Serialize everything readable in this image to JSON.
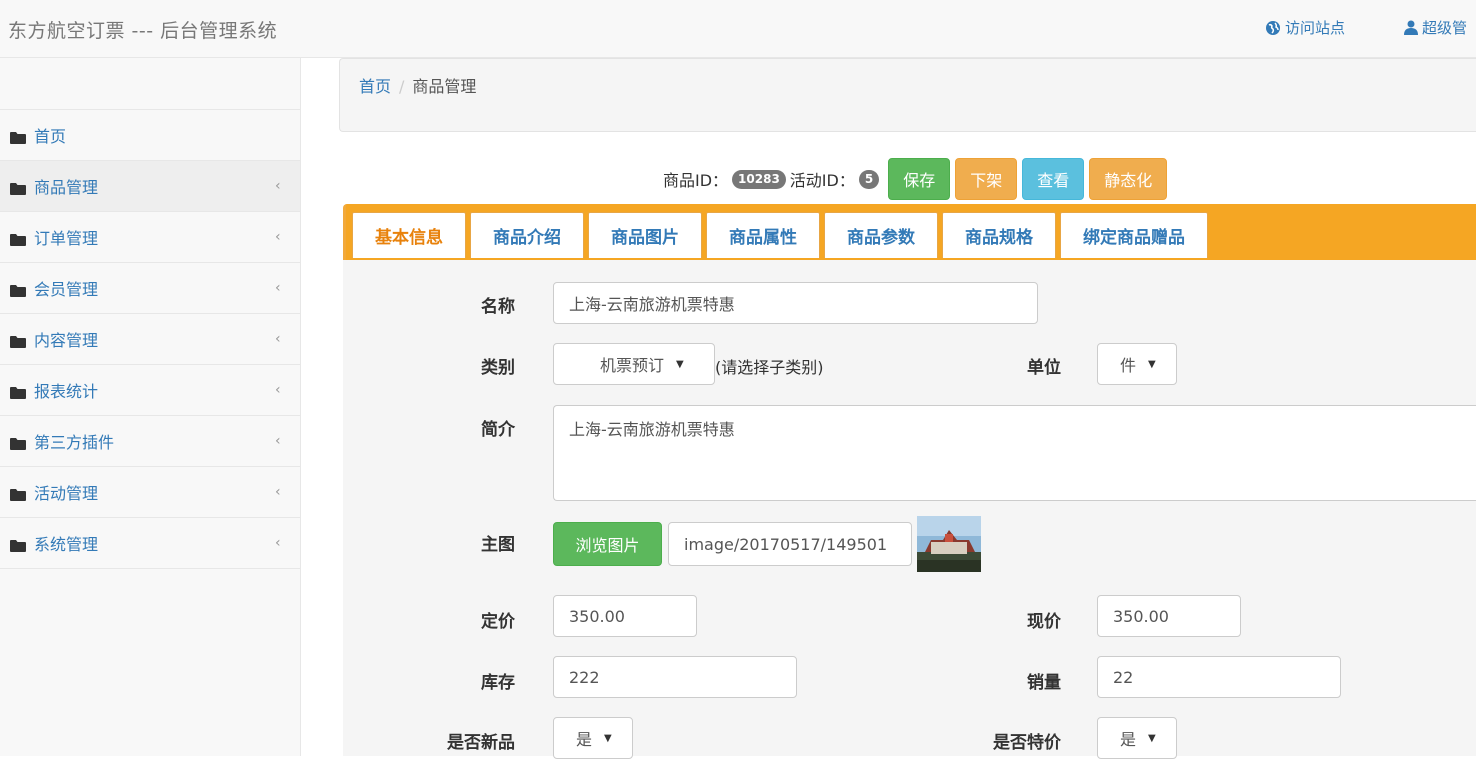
{
  "navbar": {
    "brand": "东方航空订票 --- 后台管理系统",
    "visit_site": "访问站点",
    "user": "超级管"
  },
  "sidebar": {
    "items": [
      {
        "label": "首页",
        "active": false,
        "has_chevron": false
      },
      {
        "label": "商品管理",
        "active": true,
        "has_chevron": true
      },
      {
        "label": "订单管理",
        "active": false,
        "has_chevron": true
      },
      {
        "label": "会员管理",
        "active": false,
        "has_chevron": true
      },
      {
        "label": "内容管理",
        "active": false,
        "has_chevron": true
      },
      {
        "label": "报表统计",
        "active": false,
        "has_chevron": true
      },
      {
        "label": "第三方插件",
        "active": false,
        "has_chevron": true
      },
      {
        "label": "活动管理",
        "active": false,
        "has_chevron": true
      },
      {
        "label": "系统管理",
        "active": false,
        "has_chevron": true
      }
    ],
    "chevron": "‹"
  },
  "breadcrumb": {
    "home": "首页",
    "sep": "/",
    "current": "商品管理"
  },
  "idbar": {
    "product_id_label": "商品ID：",
    "product_id": "10283",
    "activity_id_label": "活动ID：",
    "activity_id": "5",
    "save": "保存",
    "offshelf": "下架",
    "view": "查看",
    "staticize": "静态化"
  },
  "tabs": [
    "基本信息",
    "商品介绍",
    "商品图片",
    "商品属性",
    "商品参数",
    "商品规格",
    "绑定商品赠品"
  ],
  "form": {
    "name_label": "名称",
    "name_value": "上海-云南旅游机票特惠",
    "category_label": "类别",
    "category_value": "机票预订",
    "category_hint": "(请选择子类别)",
    "unit_label": "单位",
    "unit_value": "件",
    "summary_label": "简介",
    "summary_value": "上海-云南旅游机票特惠",
    "main_image_label": "主图",
    "browse_button": "浏览图片",
    "image_path": "image/20170517/149501",
    "list_price_label": "定价",
    "list_price_value": "350.00",
    "current_price_label": "现价",
    "current_price_value": "350.00",
    "stock_label": "库存",
    "stock_value": "222",
    "sales_label": "销量",
    "sales_value": "22",
    "is_new_label": "是否新品",
    "is_new_value": "是",
    "is_special_label": "是否特价",
    "is_special_value": "是"
  },
  "colors": {
    "link": "#337ab7",
    "success": "#5cb85c",
    "warning": "#f0ad4e",
    "info": "#5bc0de",
    "tab_bar": "#f5a623"
  }
}
